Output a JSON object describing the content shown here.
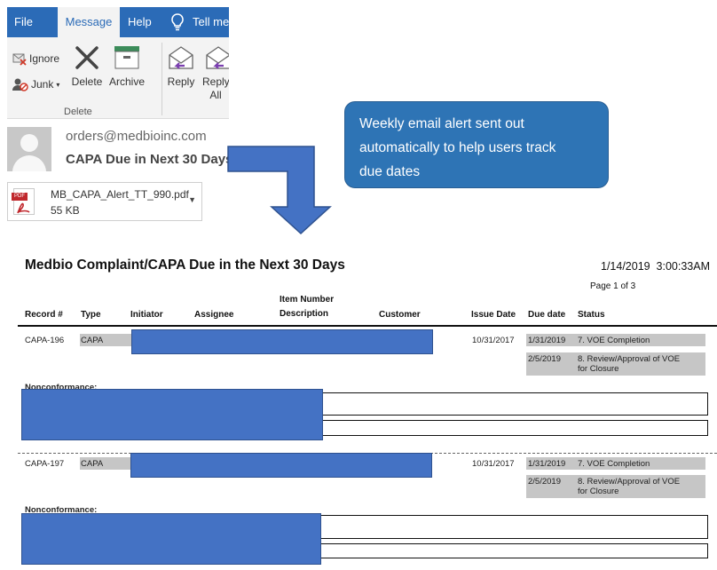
{
  "ribbon": {
    "tabs": [
      "File",
      "Message",
      "Help",
      "Tell me"
    ],
    "ignore": "Ignore",
    "junk": "Junk",
    "delete": "Delete",
    "archive": "Archive",
    "reply": "Reply",
    "reply_all_1": "Reply",
    "reply_all_2": "All",
    "group_delete": "Delete"
  },
  "message": {
    "from": "orders@medbioinc.com",
    "subject": "CAPA Due in Next 30 Days",
    "attachment": {
      "name": "MB_CAPA_Alert_TT_990.pdf",
      "size": "55 KB",
      "icon_label": "PDF"
    }
  },
  "callout": {
    "line1": "Weekly email alert sent out",
    "line2": "automatically to help users track",
    "line3": "due dates"
  },
  "report": {
    "title": "Medbio Complaint/CAPA Due in the Next 30 Days",
    "datetime": "1/14/2019  3:00:33AM",
    "page": "Page 1 of 3",
    "columns": {
      "record": "Record #",
      "type": "Type",
      "initiator": "Initiator",
      "assignee": "Assignee",
      "item_1": "Item Number",
      "item_2": "Description",
      "customer": "Customer",
      "issue_date": "Issue Date",
      "due_date": "Due date",
      "status": "Status"
    },
    "nonconformance_label": "Nonconformance:",
    "records": [
      {
        "record": "CAPA-196",
        "type": "CAPA",
        "issue_date": "10/31/2017",
        "due1": "1/31/2019",
        "status1": "7. VOE Completion",
        "due2": "2/5/2019",
        "status2a": "8. Review/Approval of VOE",
        "status2b": "for Closure",
        "nonconformance": "Nonconformance:"
      },
      {
        "record": "CAPA-197",
        "type": "CAPA",
        "issue_date": "10/31/2017",
        "due1": "1/31/2019",
        "status1": "7. VOE Completion",
        "due2": "2/5/2019",
        "status2a": "8. Review/Approval of VOE",
        "status2b": "for Closure",
        "nonconformance": "Nonconformance:"
      }
    ]
  },
  "colors": {
    "outlook_blue": "#2b6bb7",
    "callout_blue": "#2e74b5",
    "arrow_blue": "#4472c4",
    "redaction": "#4472c4",
    "row_highlight": "#c6c6c6"
  }
}
